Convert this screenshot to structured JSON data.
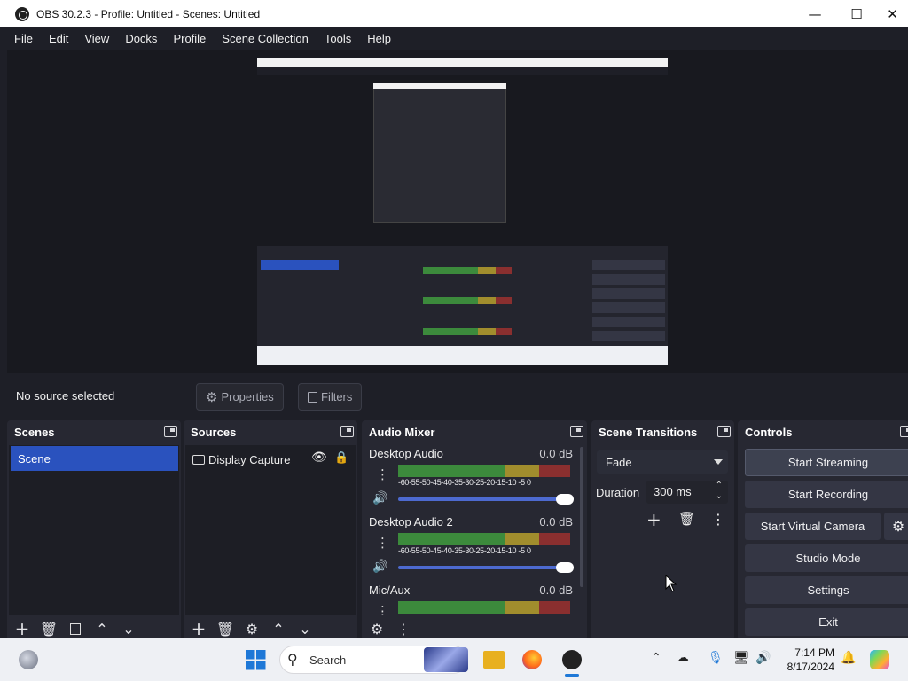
{
  "window": {
    "title": "OBS 30.2.3 - Profile: Untitled - Scenes: Untitled",
    "minimize": "—",
    "maximize": "☐",
    "close": "✕"
  },
  "menu": [
    "File",
    "Edit",
    "View",
    "Docks",
    "Profile",
    "Scene Collection",
    "Tools",
    "Help"
  ],
  "context_bar": {
    "status": "No source selected",
    "properties": "Properties",
    "filters": "Filters"
  },
  "scenes": {
    "title": "Scenes",
    "items": [
      "Scene"
    ]
  },
  "sources": {
    "title": "Sources",
    "items": [
      {
        "label": "Display Capture",
        "visible": true,
        "locked": false
      }
    ]
  },
  "audio_mixer": {
    "title": "Audio Mixer",
    "scale": "-60-55-50-45-40-35-30-25-20-15-10 -5  0",
    "channels": [
      {
        "name": "Desktop Audio",
        "db": "0.0 dB",
        "volume": 1.0
      },
      {
        "name": "Desktop Audio 2",
        "db": "0.0 dB",
        "volume": 1.0
      },
      {
        "name": "Mic/Aux",
        "db": "0.0 dB",
        "volume": 1.0
      }
    ]
  },
  "transitions": {
    "title": "Scene Transitions",
    "selected": "Fade",
    "duration_label": "Duration",
    "duration_value": "300 ms"
  },
  "controls": {
    "title": "Controls",
    "start_streaming": "Start Streaming",
    "start_recording": "Start Recording",
    "start_virtual_camera": "Start Virtual Camera",
    "studio_mode": "Studio Mode",
    "settings": "Settings",
    "exit": "Exit"
  },
  "taskbar": {
    "search": "Search",
    "time": "7:14 PM",
    "date": "8/17/2024"
  },
  "colors": {
    "accent": "#2a52be",
    "panel": "#272832",
    "background": "#1e1f27",
    "slider": "#4d6ad0"
  }
}
